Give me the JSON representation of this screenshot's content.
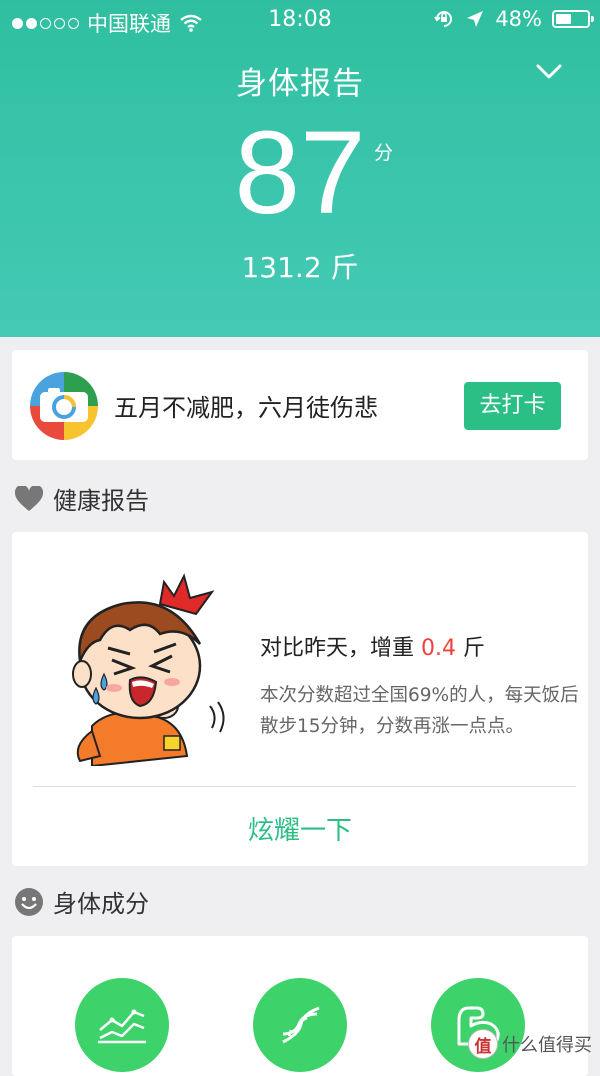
{
  "status_bar": {
    "carrier": "中国联通",
    "time": "18:08",
    "battery": "48%"
  },
  "header": {
    "title": "身体报告",
    "score": "87",
    "score_unit": "分",
    "weight": "131.2 斤"
  },
  "promo": {
    "text": "五月不减肥，六月徒伤悲",
    "button": "去打卡"
  },
  "health_report": {
    "section_title": "健康报告",
    "compare_prefix": "对比昨天，增重",
    "compare_delta": "0.4",
    "compare_unit": "斤",
    "description": "本次分数超过全国69%的人，每天饭后散步15分钟，分数再涨一点点。",
    "share": "炫耀一下"
  },
  "body_composition": {
    "section_title": "身体成分",
    "icons": [
      "trend-chart-icon",
      "dna-icon",
      "muscle-arm-icon"
    ]
  },
  "watermark": {
    "text": "什么值得买",
    "badge": "值"
  },
  "colors": {
    "header_green": "#3cc6ae",
    "accent_green": "#2bbf86",
    "delta_red": "#f2403c",
    "circle_green": "#3dd26a"
  }
}
